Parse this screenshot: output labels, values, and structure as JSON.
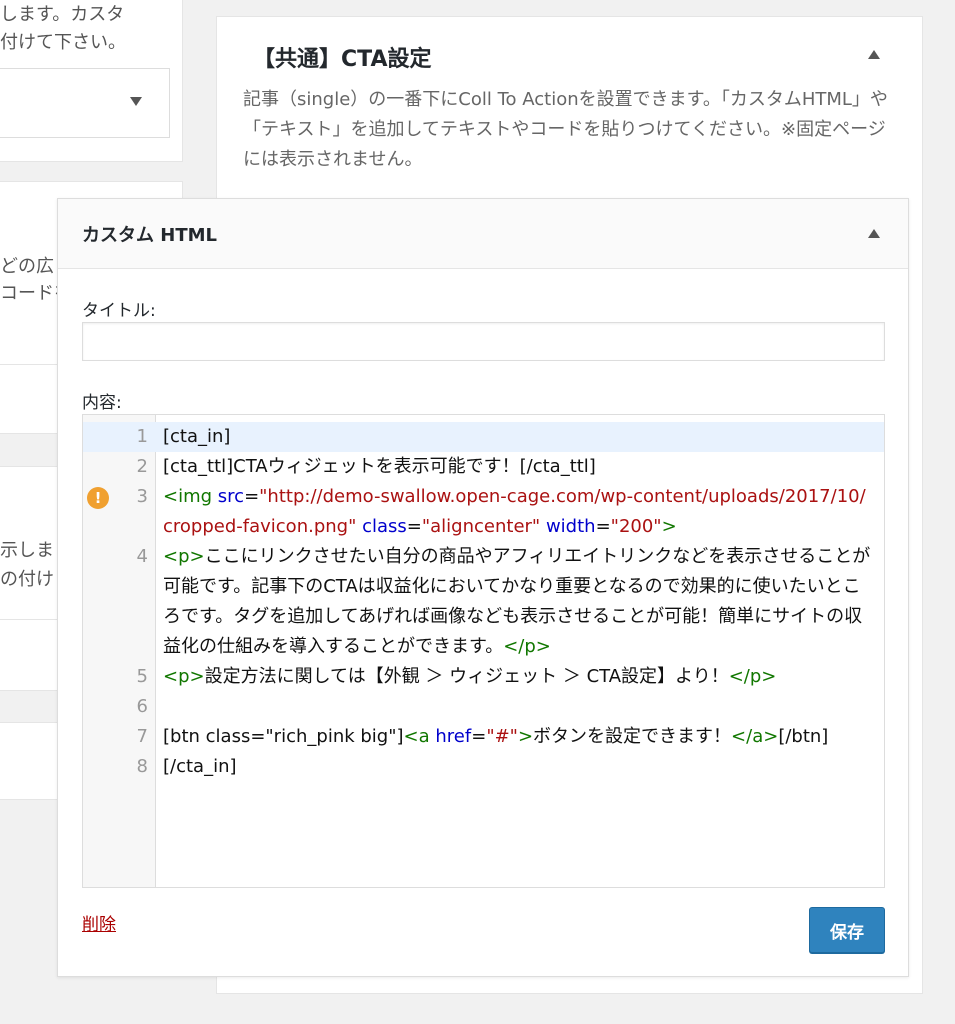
{
  "left_column": {
    "box1_line1": "します。カスタ",
    "box1_line2": "付けて下さい。",
    "box2_line1": "どの広",
    "box2_line2": "コードを",
    "box3_line1": "示しま",
    "box3_line2": "の付け"
  },
  "cta_panel": {
    "title": "【共通】CTA設定",
    "description": "記事（single）の一番下にColl To Actionを設置できます。「カスタムHTML」や「テキスト」を追加してテキストやコードを貼りつけてください。※固定ページには表示されません。"
  },
  "widget": {
    "title": "カスタム HTML",
    "title_label": "タイトル:",
    "title_value": "",
    "content_label": "内容:",
    "delete_label": "削除",
    "save_label": "保存"
  },
  "code_lines": [
    {
      "num": "1",
      "active": true,
      "warning": false,
      "tokens": [
        {
          "t": "plain",
          "v": "[cta_in]"
        }
      ]
    },
    {
      "num": "2",
      "active": false,
      "warning": false,
      "tokens": [
        {
          "t": "plain",
          "v": "[cta_ttl]CTAウィジェットを表示可能です！[/cta_ttl]"
        }
      ]
    },
    {
      "num": "3",
      "active": false,
      "warning": true,
      "tokens": [
        {
          "t": "tag",
          "v": "<img"
        },
        {
          "t": "plain",
          "v": " "
        },
        {
          "t": "attr",
          "v": "src"
        },
        {
          "t": "plain",
          "v": "="
        },
        {
          "t": "str",
          "v": "\"http://demo-swallow.open-cage.com/wp-content/uploads/2017/10/cropped-favicon.png\""
        },
        {
          "t": "plain",
          "v": " "
        },
        {
          "t": "attr",
          "v": "class"
        },
        {
          "t": "plain",
          "v": "="
        },
        {
          "t": "str",
          "v": "\"aligncenter\""
        },
        {
          "t": "plain",
          "v": " "
        },
        {
          "t": "attr",
          "v": "width"
        },
        {
          "t": "plain",
          "v": "="
        },
        {
          "t": "str",
          "v": "\"200\""
        },
        {
          "t": "tag",
          "v": ">"
        }
      ]
    },
    {
      "num": "4",
      "active": false,
      "warning": false,
      "tokens": [
        {
          "t": "tag",
          "v": "<p>"
        },
        {
          "t": "plain",
          "v": "ここにリンクさせたい自分の商品やアフィリエイトリンクなどを表示させることが可能です。記事下のCTAは収益化においてかなり重要となるので効果的に使いたいところです。タグを追加してあげれば画像なども表示させることが可能！簡単にサイトの収益化の仕組みを導入することができます。"
        },
        {
          "t": "tag",
          "v": "</p>"
        }
      ]
    },
    {
      "num": "5",
      "active": false,
      "warning": false,
      "tokens": [
        {
          "t": "tag",
          "v": "<p>"
        },
        {
          "t": "plain",
          "v": "設定方法に関しては【外観 ＞ ウィジェット ＞ CTA設定】より！"
        },
        {
          "t": "tag",
          "v": "</p>"
        }
      ]
    },
    {
      "num": "6",
      "active": false,
      "warning": false,
      "tokens": [
        {
          "t": "plain",
          "v": ""
        }
      ]
    },
    {
      "num": "7",
      "active": false,
      "warning": false,
      "tokens": [
        {
          "t": "plain",
          "v": "[btn class=\"rich_pink big\"]"
        },
        {
          "t": "tag",
          "v": "<a"
        },
        {
          "t": "plain",
          "v": " "
        },
        {
          "t": "attr",
          "v": "href"
        },
        {
          "t": "plain",
          "v": "="
        },
        {
          "t": "str",
          "v": "\"#\""
        },
        {
          "t": "tag",
          "v": ">"
        },
        {
          "t": "plain",
          "v": "ボタンを設定できます！"
        },
        {
          "t": "tag",
          "v": "</a>"
        },
        {
          "t": "plain",
          "v": "[/btn]"
        }
      ]
    },
    {
      "num": "8",
      "active": false,
      "warning": false,
      "tokens": [
        {
          "t": "plain",
          "v": "[/cta_in]"
        }
      ]
    }
  ],
  "icons": {
    "widget_toggle": "triangle-up-icon",
    "cta_toggle": "triangle-up-icon",
    "select_arrow": "triangle-down-icon",
    "lint_warning": "warning-icon"
  },
  "colors": {
    "primary_button": "#2f83be",
    "delete_link": "#aa0000",
    "code_tag": "#117700",
    "code_attr": "#0000cc",
    "code_string": "#aa1111",
    "warning": "#f0a030"
  }
}
